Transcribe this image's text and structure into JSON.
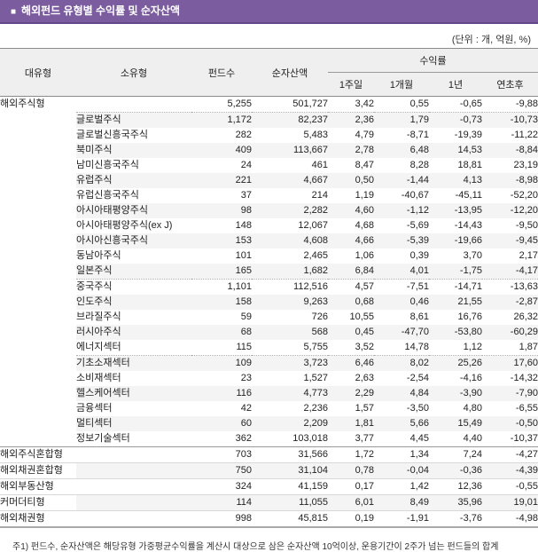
{
  "title_bar": {
    "bullet": "■",
    "title": "해외펀드 유형별 수익률 및 순자산액",
    "bg_color": "#7b5c9e",
    "text_color": "#ffffff"
  },
  "unit_note": "(단위 : 개, 억원, %)",
  "colors": {
    "accent_purple": "#7b5c9e",
    "negative_red": "#e60000",
    "stripe_gray": "#f4f4f4",
    "header_gray": "#efefef"
  },
  "table": {
    "columns": {
      "major": "대유형",
      "sub": "소유형",
      "fund_count": "펀드수",
      "net_assets": "순자산액",
      "returns_group": "수익률",
      "periods": [
        "1주일",
        "1개월",
        "1년",
        "연초후"
      ]
    },
    "rows": [
      {
        "major": "해외주식형",
        "rowspan": 23,
        "sub": "",
        "values": [
          "5,255",
          "501,727",
          "3,42",
          "0,55",
          "-0,65",
          "-9,88"
        ],
        "stripe": false,
        "sep": "dotted"
      },
      {
        "sub": "글로벌주식",
        "values": [
          "1,172",
          "82,237",
          "2,36",
          "1,79",
          "-0,73",
          "-10,73"
        ],
        "stripe": true
      },
      {
        "sub": "글로벌신흥국주식",
        "values": [
          "282",
          "5,483",
          "4,79",
          "-8,71",
          "-19,39",
          "-11,22"
        ],
        "stripe": false
      },
      {
        "sub": "북미주식",
        "values": [
          "409",
          "113,667",
          "2,78",
          "6,48",
          "14,53",
          "-8,84"
        ],
        "stripe": true
      },
      {
        "sub": "남미신흥국주식",
        "values": [
          "24",
          "461",
          "8,47",
          "8,28",
          "18,81",
          "23,19"
        ],
        "stripe": false
      },
      {
        "sub": "유럽주식",
        "values": [
          "221",
          "4,667",
          "0,50",
          "-1,44",
          "4,13",
          "-8,98"
        ],
        "stripe": true
      },
      {
        "sub": "유럽신흥국주식",
        "values": [
          "37",
          "214",
          "1,19",
          "-40,67",
          "-45,11",
          "-52,20"
        ],
        "stripe": false
      },
      {
        "sub": "아시아태평양주식",
        "values": [
          "98",
          "2,282",
          "4,60",
          "-1,12",
          "-13,95",
          "-12,20"
        ],
        "stripe": true
      },
      {
        "sub": "아시아태평양주식(ex J)",
        "values": [
          "148",
          "12,067",
          "4,68",
          "-5,69",
          "-14,43",
          "-9,50"
        ],
        "stripe": false
      },
      {
        "sub": "아시아신흥국주식",
        "values": [
          "153",
          "4,608",
          "4,66",
          "-5,39",
          "-19,66",
          "-9,45"
        ],
        "stripe": true
      },
      {
        "sub": "동남아주식",
        "values": [
          "101",
          "2,465",
          "1,06",
          "0,39",
          "3,70",
          "2,17"
        ],
        "stripe": false
      },
      {
        "sub": "일본주식",
        "values": [
          "165",
          "1,682",
          "6,84",
          "4,01",
          "-1,75",
          "-4,17"
        ],
        "stripe": true,
        "sep": "dotted"
      },
      {
        "sub": "중국주식",
        "values": [
          "1,101",
          "112,516",
          "4,57",
          "-7,51",
          "-14,71",
          "-13,63"
        ],
        "stripe": false
      },
      {
        "sub": "인도주식",
        "values": [
          "158",
          "9,263",
          "0,68",
          "0,46",
          "21,55",
          "-2,87"
        ],
        "stripe": true
      },
      {
        "sub": "브라질주식",
        "values": [
          "59",
          "726",
          "10,55",
          "8,61",
          "16,76",
          "26,32"
        ],
        "stripe": false
      },
      {
        "sub": "러시아주식",
        "values": [
          "68",
          "568",
          "0,45",
          "-47,70",
          "-53,80",
          "-60,29"
        ],
        "stripe": true
      },
      {
        "sub": "에너지섹터",
        "values": [
          "115",
          "5,755",
          "3,52",
          "14,78",
          "1,12",
          "1,87"
        ],
        "stripe": false,
        "sep": "dotted"
      },
      {
        "sub": "기초소재섹터",
        "values": [
          "109",
          "3,723",
          "6,46",
          "8,02",
          "25,26",
          "17,60"
        ],
        "stripe": true
      },
      {
        "sub": "소비재섹터",
        "values": [
          "23",
          "1,527",
          "2,63",
          "-2,54",
          "-4,16",
          "-14,32"
        ],
        "stripe": false
      },
      {
        "sub": "헬스케어섹터",
        "values": [
          "116",
          "4,773",
          "2,29",
          "4,84",
          "-3,90",
          "-7,90"
        ],
        "stripe": true
      },
      {
        "sub": "금융섹터",
        "values": [
          "42",
          "2,236",
          "1,57",
          "-3,50",
          "4,80",
          "-6,55"
        ],
        "stripe": false
      },
      {
        "sub": "멀티섹터",
        "values": [
          "60",
          "2,209",
          "1,81",
          "5,66",
          "15,49",
          "-0,50"
        ],
        "stripe": true
      },
      {
        "sub": "정보기술섹터",
        "values": [
          "362",
          "103,018",
          "3,77",
          "4,45",
          "4,40",
          "-10,37"
        ],
        "stripe": false,
        "sep": "solid"
      },
      {
        "major": "해외주식혼합형",
        "sub": "",
        "values": [
          "703",
          "31,566",
          "1,72",
          "1,34",
          "7,24",
          "-4,27"
        ],
        "stripe": false,
        "sep": "light"
      },
      {
        "major": "해외채권혼합형",
        "sub": "",
        "values": [
          "750",
          "31,104",
          "0,78",
          "-0,04",
          "-0,36",
          "-4,39"
        ],
        "stripe": true,
        "sep": "light"
      },
      {
        "major": "해외부동산형",
        "sub": "",
        "values": [
          "324",
          "41,159",
          "0,17",
          "1,42",
          "12,36",
          "-0,55"
        ],
        "stripe": false,
        "sep": "light"
      },
      {
        "major": "커머더티형",
        "sub": "",
        "values": [
          "114",
          "11,055",
          "6,01",
          "8,49",
          "35,96",
          "19,01"
        ],
        "stripe": true,
        "sep": "light"
      },
      {
        "major": "해외채권형",
        "sub": "",
        "values": [
          "998",
          "45,815",
          "0,19",
          "-1,91",
          "-3,76",
          "-4,98"
        ],
        "stripe": false,
        "sep": "bottom"
      }
    ]
  },
  "footnote": "주1) 펀드수, 순자산액은 해당유형 가중평균수익률을 계산시 대상으로 삼은 순자산액 10억이상, 운용기간이 2주가 넘는 펀드들의 합계"
}
